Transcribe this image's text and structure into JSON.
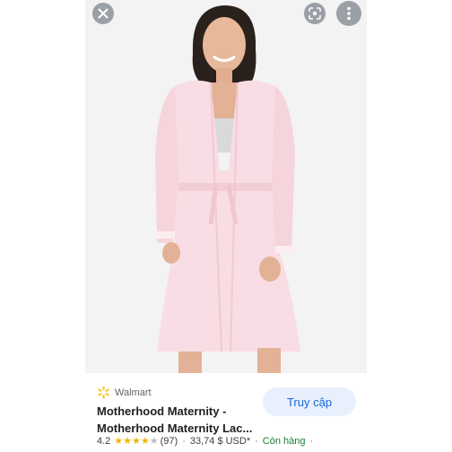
{
  "image_view": {
    "close_icon": "close-icon",
    "lens_icon": "google-lens-icon",
    "more_icon": "more-vert-icon"
  },
  "result": {
    "source": "Walmart",
    "source_icon": "walmart-spark-icon",
    "title_line1": "Motherhood Maternity -",
    "title_line2": "Motherhood Maternity Lac...",
    "visit_label": "Truy cập",
    "rating": "4.2",
    "rating_value": 4.2,
    "review_count": "(97)",
    "price": "33,74 $ USD*",
    "availability": "Còn hàng",
    "separator": "·"
  },
  "colors": {
    "accent": "#1967d2",
    "visit_bg": "#e8f0fe",
    "star": "#f4b400",
    "in_stock": "#188038",
    "walmart_spark": "#ffc220"
  }
}
